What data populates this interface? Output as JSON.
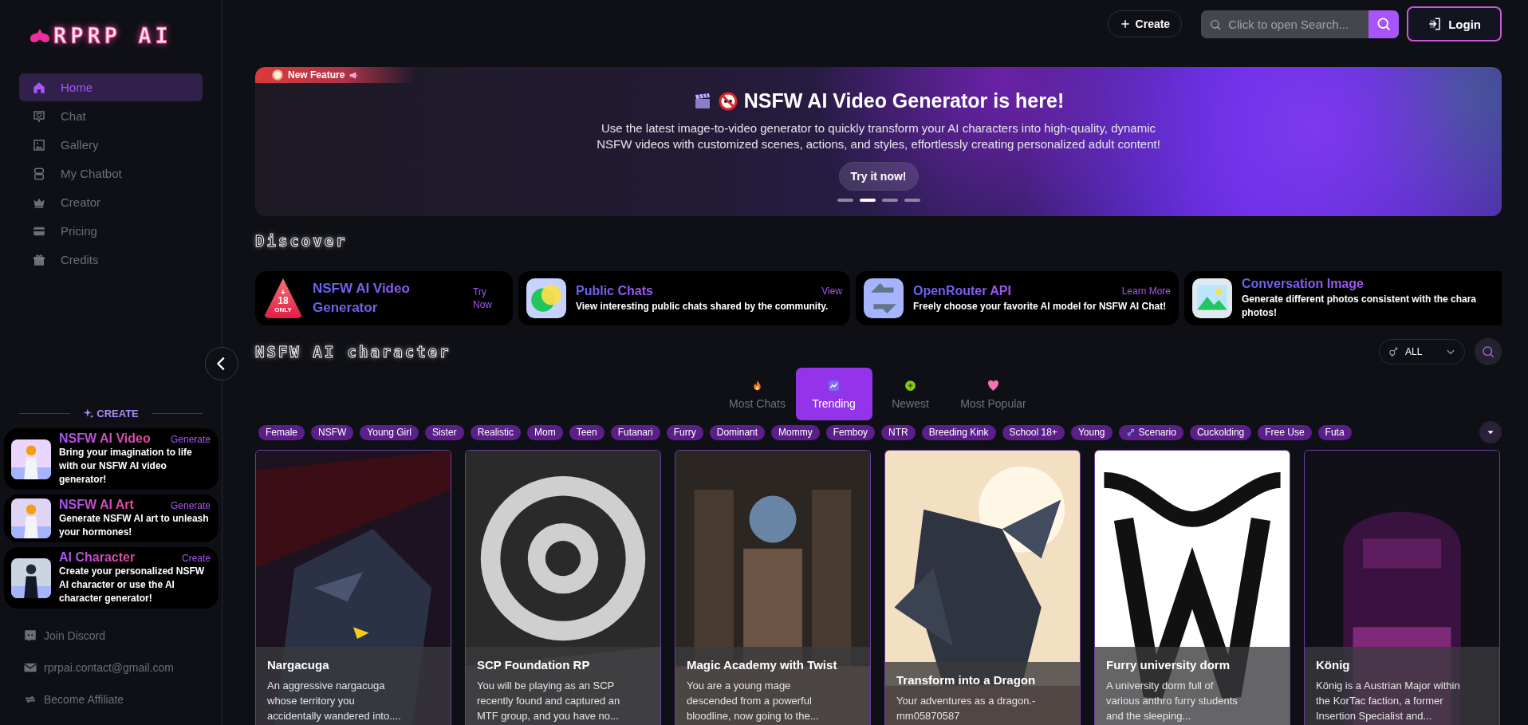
{
  "logo": {
    "text": "RPRP AI"
  },
  "header": {
    "create": "Create",
    "search": {
      "placeholder": "Click to open Search..."
    },
    "login": "Login"
  },
  "sidebar": {
    "nav": [
      {
        "label": "Home",
        "kind": "home",
        "selected": true
      },
      {
        "label": "Chat",
        "kind": "chat",
        "selected": false
      },
      {
        "label": "Gallery",
        "kind": "gallery",
        "selected": false
      },
      {
        "label": "My Chatbot",
        "kind": "robot",
        "selected": false
      },
      {
        "label": "Creator",
        "kind": "crown",
        "selected": false
      },
      {
        "label": "Pricing",
        "kind": "card",
        "selected": false
      },
      {
        "label": "Credits",
        "kind": "gift",
        "selected": false
      }
    ],
    "create_label": "CREATE",
    "promos": [
      {
        "title": "NSFW AI Video",
        "action": "Generate",
        "description": "Bring your imagination to life with our NSFW AI video generator!"
      },
      {
        "title": "NSFW AI Art",
        "action": "Generate",
        "description": "Generate NSFW AI art to unleash your hormones!"
      },
      {
        "title": "AI Character",
        "action": "Create",
        "description": "Create your personalized NSFW AI character or use the AI character generator!"
      }
    ],
    "links": [
      {
        "label": "Join Discord",
        "kind": "discord"
      },
      {
        "label": "rprpai.contact@gmail.com",
        "kind": "mail"
      },
      {
        "label": "Become Affiliate",
        "kind": "affiliate"
      }
    ]
  },
  "banner": {
    "badge": "New Feature",
    "title": "NSFW AI Video Generator is here!",
    "description": "Use the latest image-to-video generator to quickly transform your AI characters into high-quality, dynamic NSFW videos with customized scenes, actions, and styles, effortlessly creating personalized adult content!",
    "button": "Try it now!",
    "dots": [
      {
        "selected": false
      },
      {
        "selected": true
      },
      {
        "selected": false
      },
      {
        "selected": false
      }
    ]
  },
  "discover": {
    "title": "Discover",
    "items": [
      {
        "kind": "age",
        "badge_lines": [
          "+",
          "18",
          "ONLY"
        ],
        "title": "NSFW AI Video Generator",
        "action": "Try Now"
      },
      {
        "kind": "circles",
        "title": "Public Chats",
        "action": "View",
        "description": "View interesting public chats shared by the community."
      },
      {
        "kind": "arrows",
        "title": "OpenRouter API",
        "action": "Learn More",
        "description": "Freely choose your favorite AI model for NSFW AI Chat!"
      },
      {
        "kind": "landscape",
        "title": "Conversation Image",
        "description": "Generate different photos consistent with the chara\nphotos!"
      }
    ]
  },
  "characters": {
    "title": "NSFW AI character",
    "filter": "ALL",
    "tabs": [
      {
        "label": "Most Chats",
        "kind": "fire",
        "selected": false
      },
      {
        "label": "Trending",
        "kind": "chart",
        "selected": true
      },
      {
        "label": "Newest",
        "kind": "dot",
        "selected": false
      },
      {
        "label": "Most Popular",
        "kind": "heart",
        "selected": false
      }
    ],
    "tags": [
      {
        "label": "Female"
      },
      {
        "label": "NSFW"
      },
      {
        "label": "Young Girl"
      },
      {
        "label": "Sister"
      },
      {
        "label": "Realistic"
      },
      {
        "label": "Mom"
      },
      {
        "label": "Teen"
      },
      {
        "label": "Futanari"
      },
      {
        "label": "Furry"
      },
      {
        "label": "Dominant"
      },
      {
        "label": "Mommy"
      },
      {
        "label": "Femboy"
      },
      {
        "label": "NTR"
      },
      {
        "label": "Breeding Kink"
      },
      {
        "label": "School 18+"
      },
      {
        "label": "Young"
      },
      {
        "label": "Scenario",
        "kind": "link"
      },
      {
        "label": "Cuckolding"
      },
      {
        "label": "Free Use"
      },
      {
        "label": "Futa"
      }
    ],
    "cards": [
      {
        "name": "Nargacuga",
        "description": "An aggressive nargacuga\nwhose territory you\naccidentally wandered into...."
      },
      {
        "name": "SCP Foundation RP",
        "description": "You will be playing as an SCP\nrecently found and captured an\nMTF group, and you have no..."
      },
      {
        "name": "Magic Academy with Twist",
        "description": "You are a young mage\ndescended from a powerful\nbloodline, now going to the..."
      },
      {
        "name": "Transform into a Dragon",
        "description": "Your adventures as a dragon.-\nmm05870587"
      },
      {
        "name": "Furry university dorm",
        "description": "A university dorm full of\nvarious anthro furry students\nand the sleeping..."
      },
      {
        "name": "König",
        "description": "König is a Austrian Major within\nthe KorTac faction, a former\nInsertion Specialist and..."
      }
    ]
  }
}
